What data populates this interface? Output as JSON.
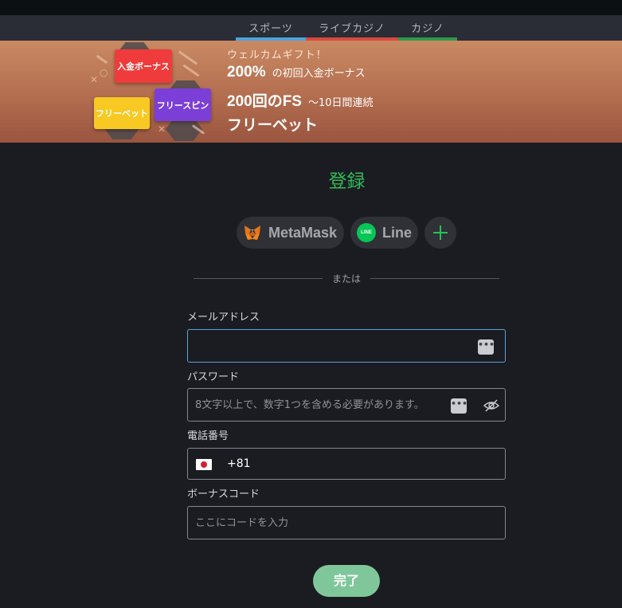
{
  "tabs": [
    {
      "label": "スポーツ"
    },
    {
      "label": "ライブカジノ"
    },
    {
      "label": "カジノ"
    }
  ],
  "banner": {
    "tags": {
      "deposit_bonus": "入金ボーナス",
      "free_spin": "フリースピン",
      "free_bet": "フリーベット"
    },
    "line1": "ウェルカムギフト！",
    "line2_big": "200%",
    "line2_small": "の初回入金ボーナス",
    "line3_big": "200回のFS",
    "line3_small": "〜10日間連続",
    "line4": "フリーベット"
  },
  "form": {
    "title": "登録",
    "social": {
      "metamask": "MetaMask",
      "line": "Line",
      "line_icon_text": "LINE",
      "more": "+"
    },
    "divider": "または",
    "email": {
      "label": "メールアドレス",
      "value": "",
      "placeholder": ""
    },
    "password": {
      "label": "パスワード",
      "placeholder": "8文字以上で、数字1つを含める必要があります。"
    },
    "phone": {
      "label": "電話番号",
      "country": "JP",
      "dial_code": "+81",
      "value": ""
    },
    "bonus": {
      "label": "ボーナスコード",
      "placeholder": "ここにコードを入力"
    },
    "submit": "完了"
  },
  "colors": {
    "accent": "#2ebd58",
    "submit": "#7fc79a",
    "focus": "#5aa3d6"
  },
  "icons": {
    "metamask": "metamask-fox-icon",
    "line": "line-app-icon",
    "plus": "plus-icon",
    "autofill": "password-manager-icon",
    "eye": "eye-off-icon",
    "flag": "japan-flag-icon"
  }
}
